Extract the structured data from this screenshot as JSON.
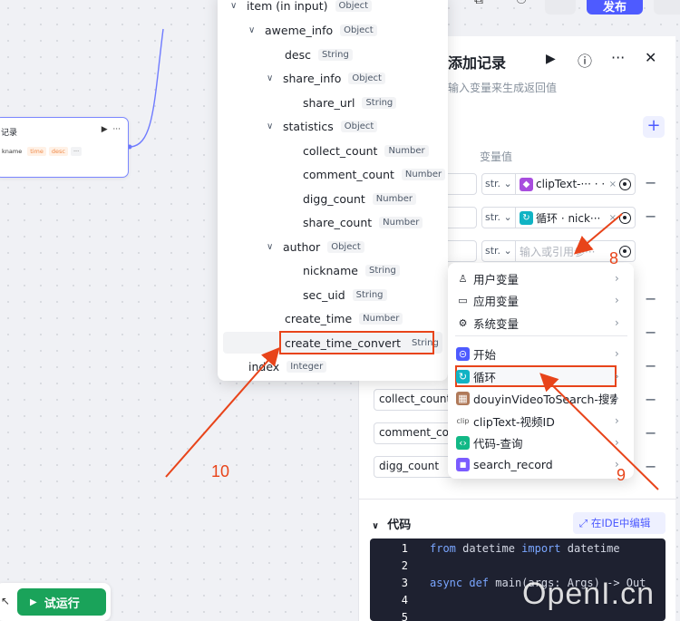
{
  "header": {
    "publish_label": "发布"
  },
  "node_card": {
    "title": "记录",
    "run_icon": "play-icon",
    "menu_icon": "more-icon",
    "tags": [
      "kname",
      "time",
      "desc"
    ]
  },
  "panel": {
    "title": "添加记录",
    "subtitle": "输入变量来生成返回值",
    "column_var_value": "变量值",
    "rows": [
      {
        "name": "",
        "type": "str.",
        "ref_label": "clipText-··· · ·",
        "ref_icon": "clip-icon"
      },
      {
        "name": "",
        "type": "str.",
        "ref_label": "循环 · nick···",
        "ref_icon": "loop-icon"
      },
      {
        "name": "",
        "type": "str.",
        "placeholder": "输入或引用参···"
      },
      {
        "name": "collect_count"
      },
      {
        "name": "comment_cou"
      },
      {
        "name": "digg_count"
      }
    ],
    "code_title": "代码",
    "ide_button": "在IDE中编辑",
    "code_lines": [
      {
        "n": "1",
        "text": "from datetime import datetime"
      },
      {
        "n": "2",
        "text": ""
      },
      {
        "n": "3",
        "text": "async def main(args: Args) -> Out"
      },
      {
        "n": "4",
        "text": ""
      },
      {
        "n": "5",
        "text": ""
      }
    ]
  },
  "tree": {
    "items": [
      {
        "label": "item (in input)",
        "type": "Object",
        "caret": true
      },
      {
        "label": "aweme_info",
        "type": "Object",
        "caret": true
      },
      {
        "label": "desc",
        "type": "String"
      },
      {
        "label": "share_info",
        "type": "Object",
        "caret": true
      },
      {
        "label": "share_url",
        "type": "String"
      },
      {
        "label": "statistics",
        "type": "Object",
        "caret": true
      },
      {
        "label": "collect_count",
        "type": "Number"
      },
      {
        "label": "comment_count",
        "type": "Number"
      },
      {
        "label": "digg_count",
        "type": "Number"
      },
      {
        "label": "share_count",
        "type": "Number"
      },
      {
        "label": "author",
        "type": "Object",
        "caret": true
      },
      {
        "label": "nickname",
        "type": "String"
      },
      {
        "label": "sec_uid",
        "type": "String"
      },
      {
        "label": "create_time",
        "type": "Number"
      },
      {
        "label": "create_time_convert",
        "type": "String"
      },
      {
        "label": "index",
        "type": "Integer"
      }
    ]
  },
  "var_menu": {
    "items": [
      {
        "label": "用户变量",
        "icon": "user-icon"
      },
      {
        "label": "应用变量",
        "icon": "folder-icon"
      },
      {
        "label": "系统变量",
        "icon": "gear-icon"
      },
      {
        "label": "开始",
        "icon": "start-icon"
      },
      {
        "label": "循环",
        "icon": "loop-icon"
      },
      {
        "label": "douyinVideoToSearch-搜索",
        "icon": "plugin-icon"
      },
      {
        "label": "clipText-视频ID",
        "icon": "clip-icon"
      },
      {
        "label": "代码-查询",
        "icon": "code-icon"
      },
      {
        "label": "search_record",
        "icon": "db-icon"
      }
    ]
  },
  "toolbar": {
    "run_label": "试运行"
  },
  "annotations": {
    "n8": "8",
    "n9": "9",
    "n10": "10"
  },
  "watermark": "OpenI.cn",
  "colors": {
    "accent": "#4e5bff",
    "run_green": "#1aa35a",
    "annotation_red": "#e8441a",
    "node_border": "#7a86ff"
  }
}
